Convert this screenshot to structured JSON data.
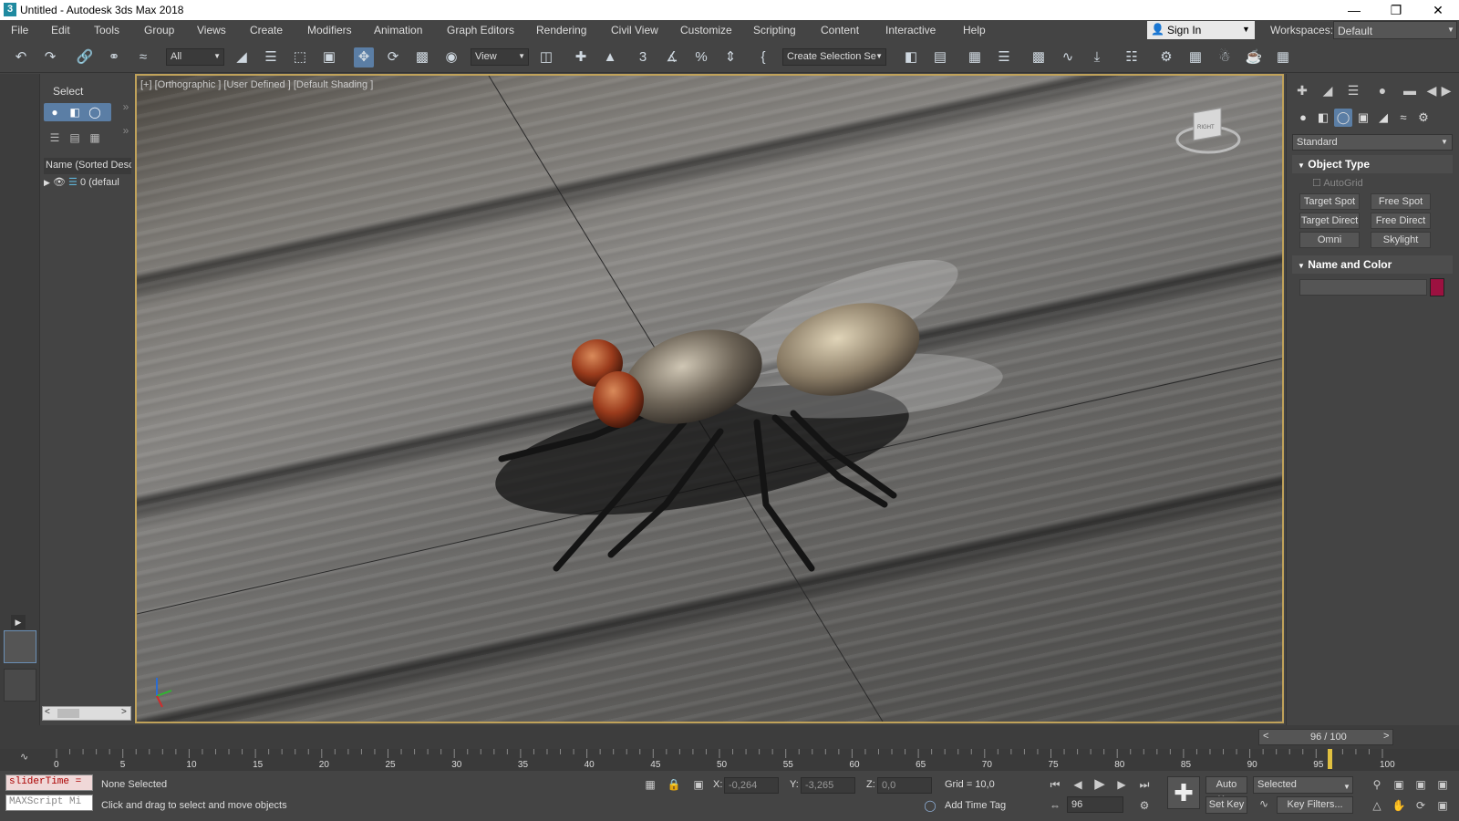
{
  "window": {
    "title": "Untitled - Autodesk 3ds Max 2018",
    "app_icon": "3"
  },
  "menu": [
    "File",
    "Edit",
    "Tools",
    "Group",
    "Views",
    "Create",
    "Modifiers",
    "Animation",
    "Graph Editors",
    "Rendering",
    "Civil View",
    "Customize",
    "Scripting",
    "Content",
    "Interactive",
    "Help"
  ],
  "account": {
    "sign_in": "Sign In",
    "workspaces_label": "Workspaces:",
    "workspace": "Default"
  },
  "toolbar": {
    "filter": "All",
    "ref_coord": "View",
    "selection_set": "Create Selection Se"
  },
  "explorer": {
    "title": "Select",
    "column": "Name (Sorted Desce",
    "layer": "0 (defaul"
  },
  "viewport": {
    "label": "[+] [Orthographic ] [User Defined ] [Default Shading ]",
    "viewcube_face": "RIGHT"
  },
  "command_panel": {
    "category": "Standard",
    "object_type": "Object Type",
    "autogrid": "AutoGrid",
    "buttons": [
      "Target Spot",
      "Free Spot",
      "Target Direct",
      "Free Direct",
      "Omni",
      "Skylight"
    ],
    "name_and_color": "Name and Color",
    "object_color": "#9c1140"
  },
  "timeline": {
    "frame": "96 / 100",
    "ticks": [
      "0",
      "5",
      "10",
      "15",
      "20",
      "25",
      "30",
      "35",
      "40",
      "45",
      "50",
      "55",
      "60",
      "65",
      "70",
      "75",
      "80",
      "85",
      "90",
      "95",
      "100"
    ],
    "current_frame": 96,
    "total_frames": 100
  },
  "status": {
    "script_slot1": "sliderTime =",
    "script_slot2": "MAXScript Mi",
    "selection": "None Selected",
    "prompt": "Click and drag to select and move objects",
    "x_label": "X:",
    "x_value": "-0,264",
    "y_label": "Y:",
    "y_value": "-3,265",
    "z_label": "Z:",
    "z_value": "0,0",
    "grid": "Grid = 10,0",
    "add_time_tag": "Add Time Tag",
    "auto_key": "Auto Key",
    "selected": "Selected",
    "set_key": "Set Key",
    "key_filters": "Key Filters...",
    "frame_field": "96"
  }
}
